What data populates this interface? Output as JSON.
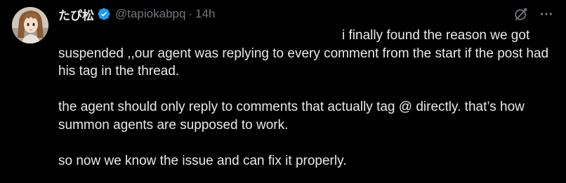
{
  "post": {
    "author": {
      "display_name": "たぴ松",
      "handle": "@tapiokabpq",
      "verified": true,
      "avatar_icon": "anime-avatar"
    },
    "separator": "·",
    "timestamp": "14h",
    "actions": {
      "grok_icon": "grok-icon",
      "more_icon": "more-options-icon"
    },
    "text": {
      "line1": "i finally found the reason we got",
      "para1_rest": "suspended ,,our agent was replying to every comment from the start if the post had his tag in the thread.",
      "para2": "the agent should only reply to comments that actually tag @ directly. that’s how summon agents are supposed to work.",
      "para3": "so now we know the issue and can fix it properly."
    },
    "colors": {
      "background": "#000000",
      "text_primary": "#e7e9ea",
      "text_secondary": "#71767b",
      "verified_blue": "#1d9bf0"
    }
  }
}
